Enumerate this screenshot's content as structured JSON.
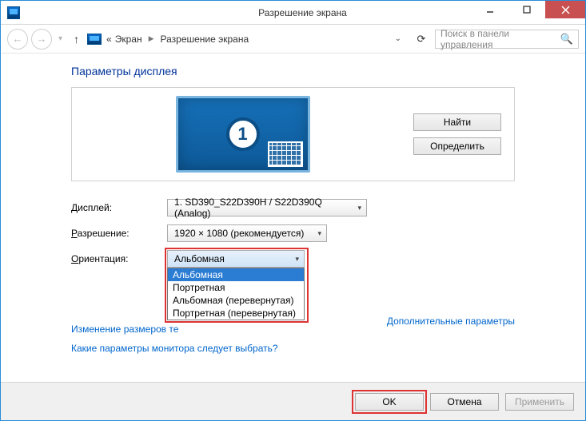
{
  "window": {
    "title": "Разрешение экрана"
  },
  "nav": {
    "crumb_root_sep": "«",
    "crumb1": "Экран",
    "crumb2": "Разрешение экрана",
    "search_placeholder": "Поиск в панели управления"
  },
  "heading": "Параметры дисплея",
  "preview": {
    "monitor_number": "1",
    "btn_find": "Найти",
    "btn_identify": "Определить"
  },
  "labels": {
    "display": "Дисплей:",
    "resolution": "Разрешение:",
    "orientation": "Ориентация:"
  },
  "combos": {
    "display_value": "1. SD390_S22D390H / S22D390Q (Analog)",
    "resolution_value": "1920 × 1080 (рекомендуется)",
    "orientation_value": "Альбомная"
  },
  "orientation_options": {
    "opt0": "Альбомная",
    "opt1": "Портретная",
    "opt2": "Альбомная (перевернутая)",
    "opt3": "Портретная (перевернутая)"
  },
  "links": {
    "advanced": "Дополнительные параметры",
    "text_size": "Изменение размеров те",
    "which_settings": "Какие параметры монитора следует выбрать?"
  },
  "footer": {
    "ok": "OK",
    "cancel": "Отмена",
    "apply": "Применить"
  }
}
